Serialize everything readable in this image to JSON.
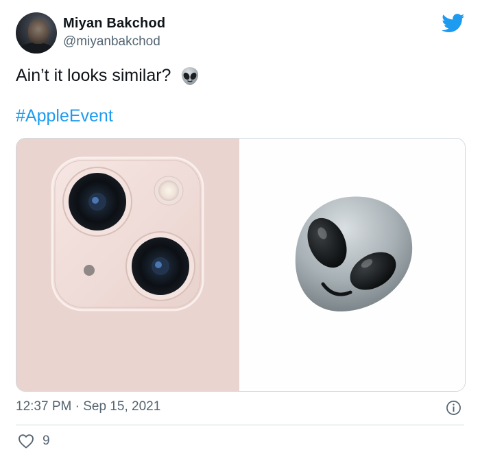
{
  "author": {
    "display_name": "Miyan Bakchod",
    "handle": "@miyanbakchod",
    "avatar_icon": "profile-photo",
    "platform_icon": "twitter-bird-icon",
    "brand_color": "#1d9bf0"
  },
  "tweet": {
    "text": "Ain’t it looks similar?",
    "emoji": "alien-emoji",
    "hashtag": "#AppleEvent"
  },
  "media": {
    "left_image": "iphone-13-pink-camera-module",
    "right_image": "alien-emoji-large"
  },
  "meta": {
    "time": "12:37 PM",
    "separator": "·",
    "date": "Sep 15, 2021",
    "info_icon": "info-icon"
  },
  "actions": {
    "like_icon": "heart-icon",
    "like_count": "9"
  }
}
